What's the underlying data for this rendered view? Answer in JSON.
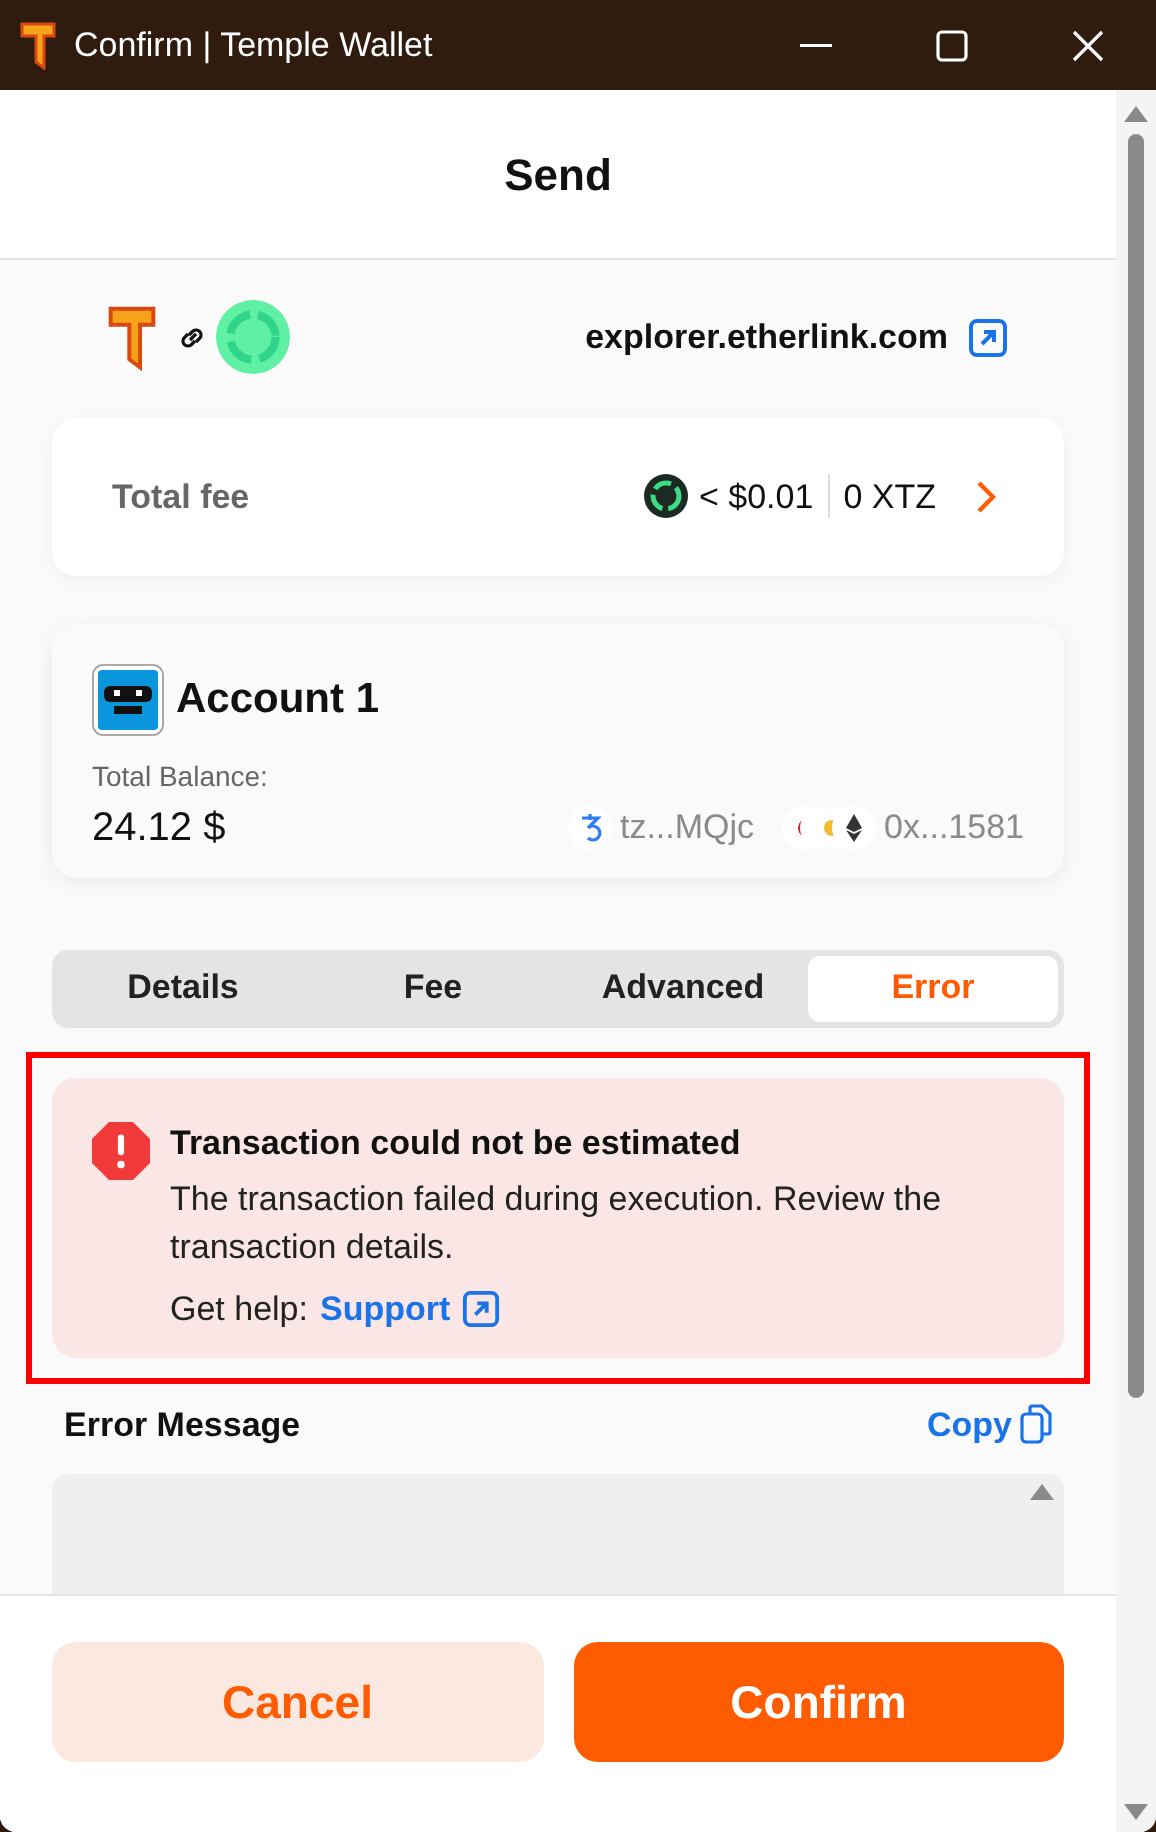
{
  "window": {
    "title": "Confirm | Temple Wallet"
  },
  "header": {
    "title": "Send"
  },
  "site": {
    "domain": "explorer.etherlink.com"
  },
  "fee": {
    "label": "Total fee",
    "fiat": "< $0.01",
    "amount": "0 XTZ"
  },
  "account": {
    "name": "Account 1",
    "balance_label": "Total Balance:",
    "balance": "24.12 $",
    "addresses": [
      {
        "kind": "tezos",
        "text": "tz...MQjc"
      },
      {
        "kind": "evm",
        "text": "0x...1581"
      }
    ]
  },
  "tabs": [
    {
      "label": "Details",
      "selected": false
    },
    {
      "label": "Fee",
      "selected": false
    },
    {
      "label": "Advanced",
      "selected": false
    },
    {
      "label": "Error",
      "selected": true
    }
  ],
  "alert": {
    "highlighted": true,
    "title": "Transaction could not be estimated",
    "message": "The transaction failed during execution. Review the transaction details.",
    "help_label": "Get help:",
    "help_link": "Support"
  },
  "error_message": {
    "label": "Error Message",
    "copy": "Copy"
  },
  "buttons": [
    {
      "kind": "secondary",
      "label": "Cancel"
    },
    {
      "kind": "primary",
      "label": "Confirm"
    }
  ]
}
